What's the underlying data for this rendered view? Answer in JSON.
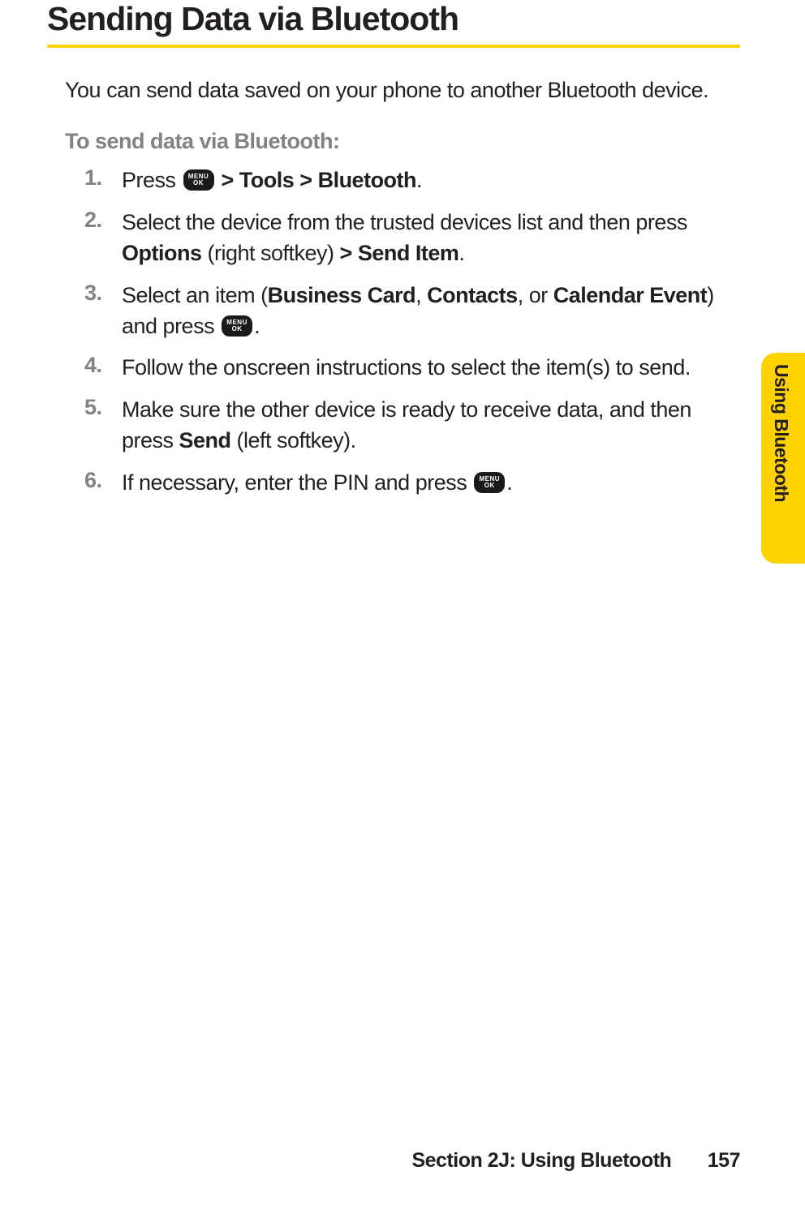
{
  "title": "Sending Data via Bluetooth",
  "intro": "You can send data saved on your phone to another Bluetooth device.",
  "subheading": "To send data via Bluetooth:",
  "icon": {
    "line1": "MENU",
    "line2": "OK"
  },
  "steps": {
    "s1": {
      "num": "1.",
      "t1": "Press ",
      "t2": " > Tools > Bluetooth",
      "t3": "."
    },
    "s2": {
      "num": "2.",
      "t1": "Select the device from the trusted devices list and then press ",
      "b1": "Options",
      "t2": " (right softkey) ",
      "b2": "> Send Item",
      "t3": "."
    },
    "s3": {
      "num": "3.",
      "t1": "Select an item (",
      "b1": "Business Card",
      "t2": ", ",
      "b2": "Contacts",
      "t3": ", or ",
      "b3": "Calendar Event",
      "t4": ") and press ",
      "t5": "."
    },
    "s4": {
      "num": "4.",
      "t1": "Follow the onscreen instructions to select the item(s) to send."
    },
    "s5": {
      "num": "5.",
      "t1": "Make sure the other device is ready to receive data, and then press ",
      "b1": "Send",
      "t2": " (left softkey)."
    },
    "s6": {
      "num": "6.",
      "t1": "If necessary, enter the PIN and press ",
      "t2": "."
    }
  },
  "sideTab": "Using Bluetooth",
  "footer": {
    "section": "Section 2J: Using Bluetooth",
    "page": "157"
  }
}
